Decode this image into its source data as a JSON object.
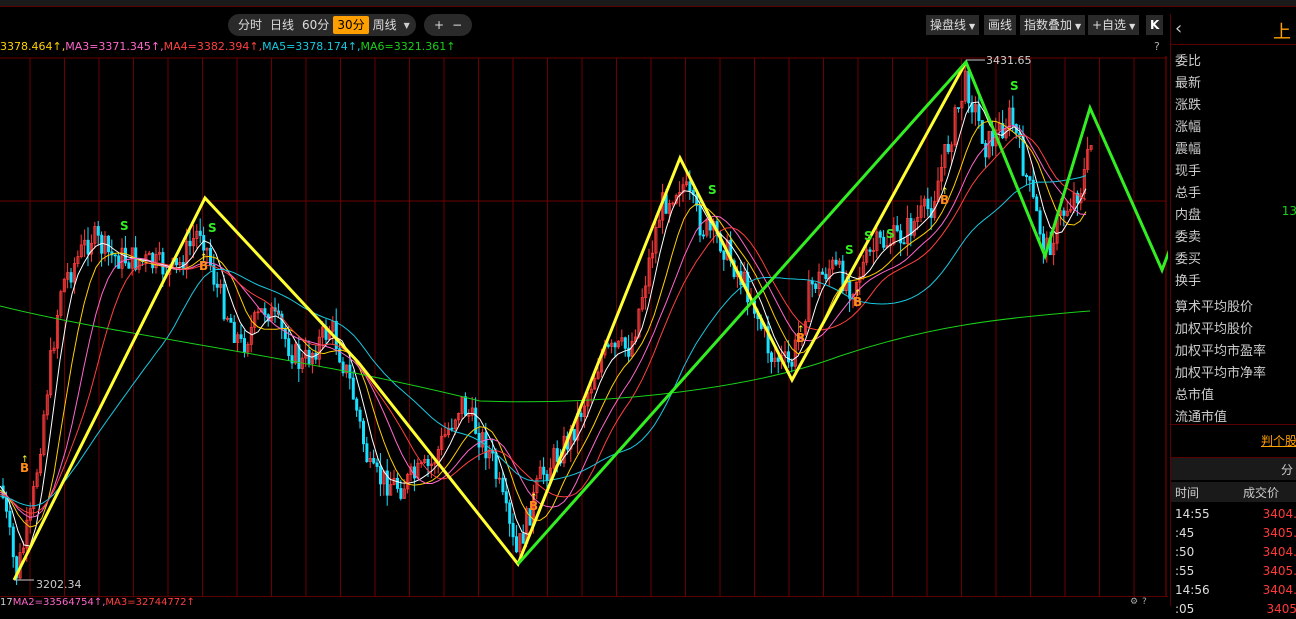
{
  "toolbar": {
    "tabs": [
      {
        "label": "分时",
        "active": false
      },
      {
        "label": "日线",
        "active": false
      },
      {
        "label": "60分",
        "active": false
      },
      {
        "label": "30分",
        "active": true
      },
      {
        "label": "周线",
        "active": false
      }
    ],
    "zoom_in": "+",
    "zoom_out": "−",
    "right_buttons": [
      "操盘线",
      "画线",
      "指数叠加",
      "+自选"
    ],
    "close_glyph": "K"
  },
  "ma_legend": [
    {
      "text": "3378.464↑,",
      "color": "#ffd000"
    },
    {
      "text": "MA3=3371.345↑,",
      "color": "#ff66cc"
    },
    {
      "text": "MA4=3382.394↑,",
      "color": "#ff4040"
    },
    {
      "text": "MA5=3378.174↑,",
      "color": "#19c8e0"
    },
    {
      "text": "MA6=3321.361↑",
      "color": "#19d019"
    }
  ],
  "help_mark": "?",
  "chart": {
    "high_label": "3431.65",
    "low_label": "3202.34",
    "buy_label": "B",
    "sell_label": "S"
  },
  "bottom_legend": [
    {
      "text": "17",
      "color": "#ccc"
    },
    {
      "text": "MA2=33564754↑,",
      "color": "#ff66cc"
    },
    {
      "text": "MA3=32744772↑",
      "color": "#ff4040"
    }
  ],
  "side": {
    "title": "上",
    "items": [
      "委比",
      "最新",
      "涨跌",
      "涨幅",
      "震幅",
      "现手",
      "总手",
      "内盘",
      "委卖",
      "委买",
      "换手",
      "算术平均股价",
      "加权平均股价",
      "加权平均市盈率",
      "加权平均市净率",
      "总市值",
      "流通市值"
    ],
    "inner_value": "13",
    "link": "判个股",
    "section_tab": "分",
    "table_headers": [
      "时间",
      "成交价"
    ],
    "table_rows": [
      {
        "time": "14:55",
        "price": "3404."
      },
      {
        "time": ":45",
        "price": "3405."
      },
      {
        "time": ":50",
        "price": "3404."
      },
      {
        "time": ":55",
        "price": "3405."
      },
      {
        "time": "14:56",
        "price": "3404."
      },
      {
        "time": ":05",
        "price": "3405"
      }
    ]
  },
  "colors": {
    "up": "#ff3b3b",
    "down": "#19e0ff",
    "grid": "#6a0000",
    "yellow_zigzag": "#ffff33",
    "green_zigzag": "#33ee22"
  }
}
